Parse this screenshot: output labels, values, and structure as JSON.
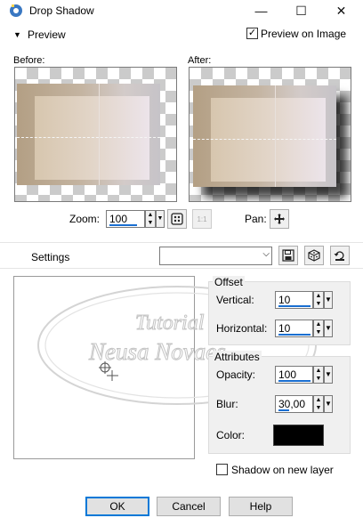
{
  "window": {
    "title": "Drop Shadow",
    "minimize_glyph": "—",
    "maximize_glyph": "☐",
    "close_glyph": "✕"
  },
  "preview": {
    "toggle_label": "Preview",
    "preview_on_image_label": "Preview on Image",
    "preview_on_image_checked": true,
    "before_label": "Before:",
    "after_label": "After:"
  },
  "zoom": {
    "label": "Zoom:",
    "value": "100",
    "pan_label": "Pan:"
  },
  "settings": {
    "label": "Settings",
    "selected": ""
  },
  "offset": {
    "title": "Offset",
    "vertical_label": "Vertical:",
    "vertical_value": "10",
    "horizontal_label": "Horizontal:",
    "horizontal_value": "10"
  },
  "attributes": {
    "title": "Attributes",
    "opacity_label": "Opacity:",
    "opacity_value": "100",
    "blur_label": "Blur:",
    "blur_value": "30,00",
    "color_label": "Color:",
    "color_value": "#000000"
  },
  "options": {
    "shadow_on_new_layer_label": "Shadow on new layer",
    "shadow_on_new_layer_checked": false
  },
  "buttons": {
    "ok": "OK",
    "cancel": "Cancel",
    "help": "Help"
  },
  "watermark": {
    "line1": "Tutorial by",
    "line2": "Neusa Novaes"
  },
  "colors": {
    "accent": "#0078d7",
    "dialog_bg": "#f0f0f0"
  }
}
